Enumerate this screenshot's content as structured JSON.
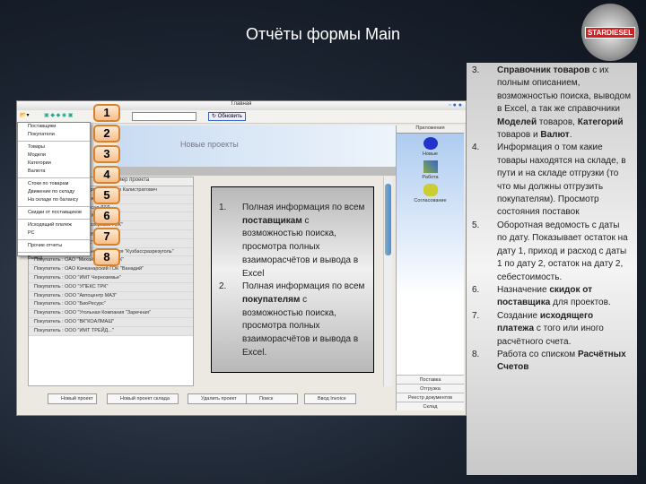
{
  "slide": {
    "title": "Отчёты формы Main",
    "logo_text": "STARDIESEL"
  },
  "app": {
    "window_title": "Главная",
    "refresh_label": "Обновить",
    "banner_title": "Новые проекты",
    "list_header": "Номер проекта",
    "menu": [
      "Поставщики",
      "Покупатели",
      "Товары",
      "Модели",
      "Категории",
      "Валюта",
      "Стоки по товарам",
      "Движение по складу",
      "На складе по балансу",
      "Скидки от поставщиков",
      "Исходящий платеж",
      "РС",
      "Прочие отчеты",
      "Выход"
    ],
    "rows": [
      "Покупатель : ИП Белобородов Виктор Калистратович",
      "Покупатель : ИП Владимир Кузнецов",
      "Покупатель : ИП ...ниверсал ЛТД",
      "Покупатель : ИП Иванов М.А.",
      "Покупатель : ОАО \"Белоозерский ГОК\"",
      "Покупатель : ОАО \"Нойбургнефтегаз\"",
      "Покупатель : ОАО \"СУЭК\"",
      "Покупатель : ОАО \"Угольная Компания \"Кузбассразрезуголь\"",
      "Покупатель : ОАО \"Михайловский ГОК\"",
      "Покупатель : ОАО Качканарский ГОК \"Ванадий\"",
      "Покупатель : ООО \"ИМТ Черноземье\"",
      "Покупатель : ООО \"УПЕКС ТРК\"",
      "Покупатель : ООО \"Автоцентр МАЗ\"",
      "Покупатель : ООО \"БиоРесурс\"",
      "Покупатель : ООО \"Угольная Компания \"Заречная\"",
      "Покупатель : ООО \"ВК\"КОАЛМАШ\"",
      "Покупатель : ООО \"ИМТ ТРЕЙД...\""
    ],
    "side_header": "Приложения",
    "side_apps": [
      "Новые",
      "Работа",
      "Согласование"
    ],
    "side_footer": [
      "Поставка",
      "Отгрузка",
      "Реестр документов",
      "Склад"
    ],
    "buttons": [
      "Новый проект",
      "Новый проект склада",
      "Удалить проект",
      "Поиск",
      "Ввод Invoice"
    ]
  },
  "callouts": [
    "1",
    "2",
    "3",
    "4",
    "5",
    "6",
    "7",
    "8"
  ],
  "box1": [
    {
      "n": "1.",
      "a": "Полная информация по всем ",
      "b": "поставщикам",
      "c": " с возможностью поиска, просмотра полных взаиморасчётов и вывода в Excel"
    },
    {
      "n": "2.",
      "a": "Полная информация по всем ",
      "b": "покупателям",
      "c": " с возможностью поиска, просмотра полных взаиморасчётов и вывода в Excel."
    }
  ],
  "box2": [
    {
      "n": "3.",
      "t": [
        [
          "b",
          "Справочник товаров"
        ],
        [
          "",
          "с их полным описанием, возможностью поиска, выводом в Excel, а так же справочники "
        ],
        [
          "b",
          "Моделей"
        ],
        [
          "",
          " товаров, "
        ],
        [
          "b",
          "Категорий"
        ],
        [
          "",
          " товаров и "
        ],
        [
          "b",
          "Валют"
        ],
        [
          "",
          "."
        ]
      ]
    },
    {
      "n": "4.",
      "t": [
        [
          "",
          "Информация о том какие товары находятся на складе, в пути и на складе отгрузки (то что мы должны отгрузить покупателям). Просмотр состояния поставок"
        ]
      ]
    },
    {
      "n": "5.",
      "t": [
        [
          "",
          "Оборотная ведомость с даты по дату. Показывает остаток на дату 1, приход и расход с даты 1 по дату 2, остаток на дату 2, себестоимость."
        ]
      ]
    },
    {
      "n": "6.",
      "t": [
        [
          "",
          "Назначение  "
        ],
        [
          "b",
          "скидок от поставщика"
        ],
        [
          "",
          " для проектов."
        ]
      ]
    },
    {
      "n": "7.",
      "t": [
        [
          "",
          "Создание "
        ],
        [
          "b",
          "исходящего платежа"
        ],
        [
          "",
          " с того или иного расчётного счета."
        ]
      ]
    },
    {
      "n": "8.",
      "t": [
        [
          "",
          "Работа со списком "
        ],
        [
          "b",
          "Расчётных Счетов"
        ]
      ]
    }
  ]
}
